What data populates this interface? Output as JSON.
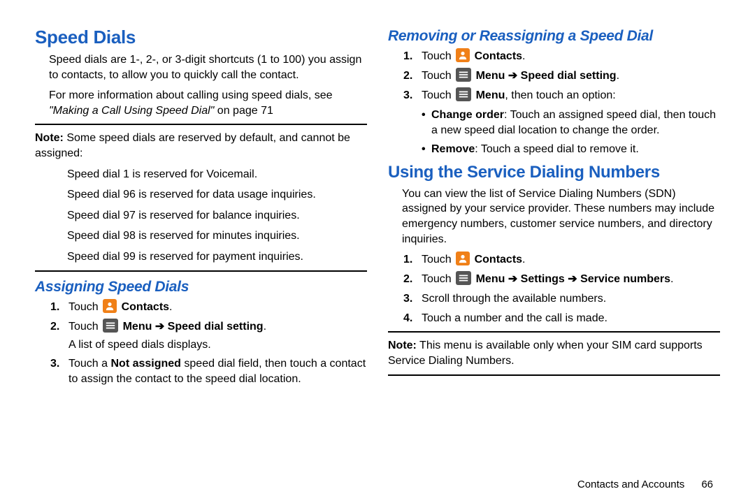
{
  "left": {
    "h1": "Speed Dials",
    "p1": "Speed dials are 1-, 2-, or 3-digit shortcuts (1 to 100) you assign to contacts, to allow you to quickly call the contact.",
    "p2_lead": "For more information about calling using speed dials, see ",
    "p2_xref": "\"Making a Call Using Speed Dial\"",
    "p2_tail": " on page 71",
    "note_label": "Note:",
    "note_intro": " Some speed dials are reserved by default, and cannot be assigned:",
    "note_l1": "Speed dial 1 is reserved for Voicemail.",
    "note_l2": "Speed dial 96 is reserved for data usage inquiries.",
    "note_l3": "Speed dial 97 is reserved for balance inquiries.",
    "note_l4": "Speed dial 98 is reserved for minutes inquiries.",
    "note_l5": "Speed dial 99 is reserved for payment inquiries.",
    "h2": "Assigning Speed Dials",
    "s1_a": "Touch ",
    "s1_b": " Contacts",
    "s1_c": ".",
    "s2_a": "Touch ",
    "s2_b": " Menu ",
    "s2_arrow": "➔",
    "s2_c": " Speed dial setting",
    "s2_d": ".",
    "s2_sub": "A list of speed dials displays.",
    "s3_a": "Touch a ",
    "s3_b": "Not assigned",
    "s3_c": " speed dial field, then touch a contact to assign the contact to the speed dial location."
  },
  "right": {
    "h2a": "Removing or Reassigning a Speed Dial",
    "r1_a": "Touch ",
    "r1_b": " Contacts",
    "r1_c": ".",
    "r2_a": "Touch ",
    "r2_b": " Menu ",
    "r2_arrow": "➔",
    "r2_c": " Speed dial setting",
    "r2_d": ".",
    "r3_a": "Touch ",
    "r3_b": " Menu",
    "r3_c": ", then touch an option:",
    "b1_a": "Change order",
    "b1_b": ": Touch an assigned speed dial, then touch a new speed dial location to change the order.",
    "b2_a": "Remove",
    "b2_b": ": Touch a speed dial to remove it.",
    "h1b": "Using the Service Dialing Numbers",
    "sdn_desc": "You can view the list of Service Dialing Numbers (SDN) assigned by your service provider. These numbers may include emergency numbers, customer service numbers, and directory inquiries.",
    "u1_a": "Touch ",
    "u1_b": " Contacts",
    "u1_c": ".",
    "u2_a": "Touch ",
    "u2_b": " Menu ",
    "u2_arrow1": "➔",
    "u2_c": " Settings ",
    "u2_arrow2": "➔",
    "u2_d": " Service numbers",
    "u2_e": ".",
    "u3": "Scroll through the available numbers.",
    "u4": "Touch a number and the call is made.",
    "note2_label": "Note:",
    "note2_text": " This menu is available only when your SIM card supports Service Dialing Numbers."
  },
  "footer": {
    "section": "Contacts and Accounts",
    "page": "66"
  }
}
